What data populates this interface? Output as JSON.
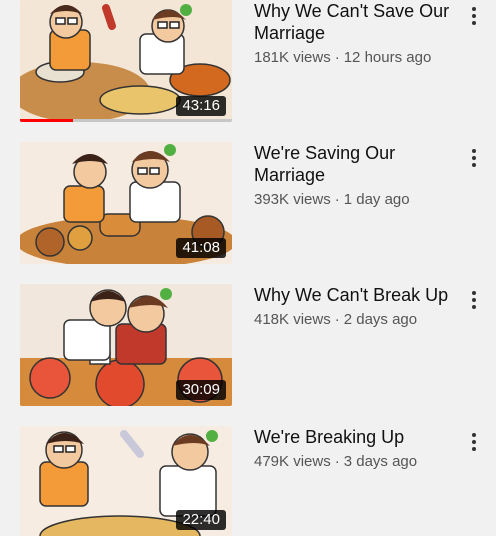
{
  "videos": [
    {
      "title": "Why We Can't Save Our Marriage",
      "views": "181K views",
      "age": "12 hours ago",
      "duration": "43:16"
    },
    {
      "title": "We're Saving Our Marriage",
      "views": "393K views",
      "age": "1 day ago",
      "duration": "41:08"
    },
    {
      "title": "Why We Can't Break Up",
      "views": "418K views",
      "age": "2 days ago",
      "duration": "30:09"
    },
    {
      "title": "We're Breaking Up",
      "views": "479K views",
      "age": "3 days ago",
      "duration": "22:40"
    }
  ],
  "icons": {
    "more": "more-vert-icon"
  },
  "colors": {
    "duration_bg": "#000000",
    "progress": "#ff0000"
  },
  "watch_progress": [
    0.25,
    0,
    0,
    0
  ]
}
